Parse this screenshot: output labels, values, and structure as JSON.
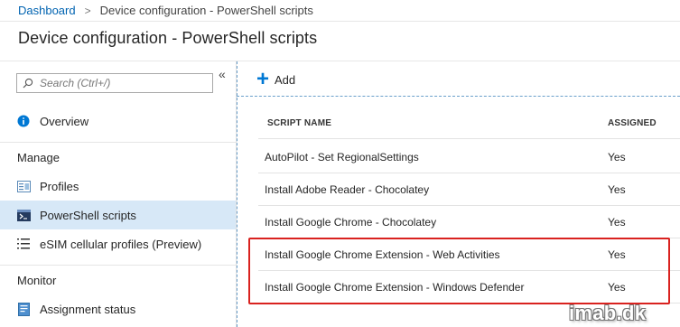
{
  "breadcrumb": {
    "root": "Dashboard",
    "separator": ">",
    "current": "Device configuration - PowerShell scripts"
  },
  "page_title": "Device configuration - PowerShell scripts",
  "sidebar": {
    "search_placeholder": "Search (Ctrl+/)",
    "collapse_label": "«",
    "items": [
      {
        "label": "Overview",
        "icon": "info-icon"
      },
      {
        "label": "Profiles",
        "icon": "profiles-icon"
      },
      {
        "label": "PowerShell scripts",
        "icon": "powershell-icon",
        "selected": true
      },
      {
        "label": "eSIM cellular profiles (Preview)",
        "icon": "esim-icon"
      },
      {
        "label": "Assignment status",
        "icon": "assignment-icon"
      }
    ],
    "sections": {
      "manage": "Manage",
      "monitor": "Monitor"
    }
  },
  "toolbar": {
    "add_label": "Add"
  },
  "table": {
    "columns": [
      "SCRIPT NAME",
      "ASSIGNED"
    ],
    "rows": [
      {
        "name": "AutoPilot - Set RegionalSettings",
        "assigned": "Yes"
      },
      {
        "name": "Install Adobe Reader - Chocolatey",
        "assigned": "Yes"
      },
      {
        "name": "Install Google Chrome - Chocolatey",
        "assigned": "Yes"
      },
      {
        "name": "Install Google Chrome Extension - Web Activities",
        "assigned": "Yes"
      },
      {
        "name": "Install Google Chrome Extension - Windows Defender",
        "assigned": "Yes"
      }
    ]
  },
  "watermark": "imab.dk",
  "colors": {
    "accent": "#0078d4",
    "link": "#0063b1",
    "selected_bg": "#d7e8f7",
    "highlight_border": "#d9221f"
  }
}
